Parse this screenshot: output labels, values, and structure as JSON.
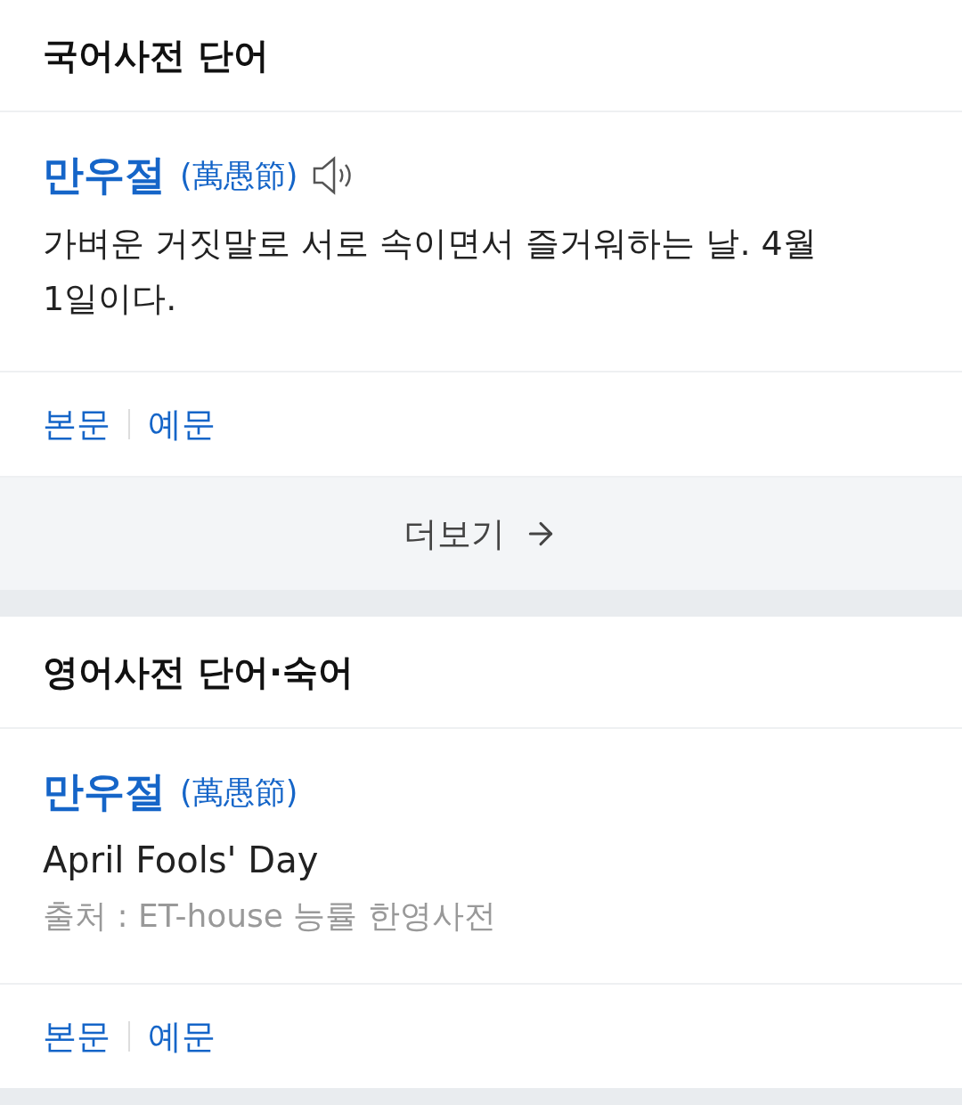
{
  "sections": [
    {
      "title": "국어사전 단어",
      "entry": {
        "word": "만우절",
        "hanja": "(萬愚節)",
        "has_audio": true,
        "definition": "가벼운 거짓말로 서로 속이면서 즐거워하는 날. 4월 1일이다.",
        "links": [
          "본문",
          "예문"
        ]
      },
      "more": {
        "label": "더보기"
      }
    },
    {
      "title": "영어사전 단어·숙어",
      "entry": {
        "word": "만우절",
        "hanja": "(萬愚節)",
        "has_audio": false,
        "definition": "April Fools' Day",
        "source": "출처 : ET-house 능률 한영사전",
        "links": [
          "본문",
          "예문"
        ]
      }
    }
  ]
}
